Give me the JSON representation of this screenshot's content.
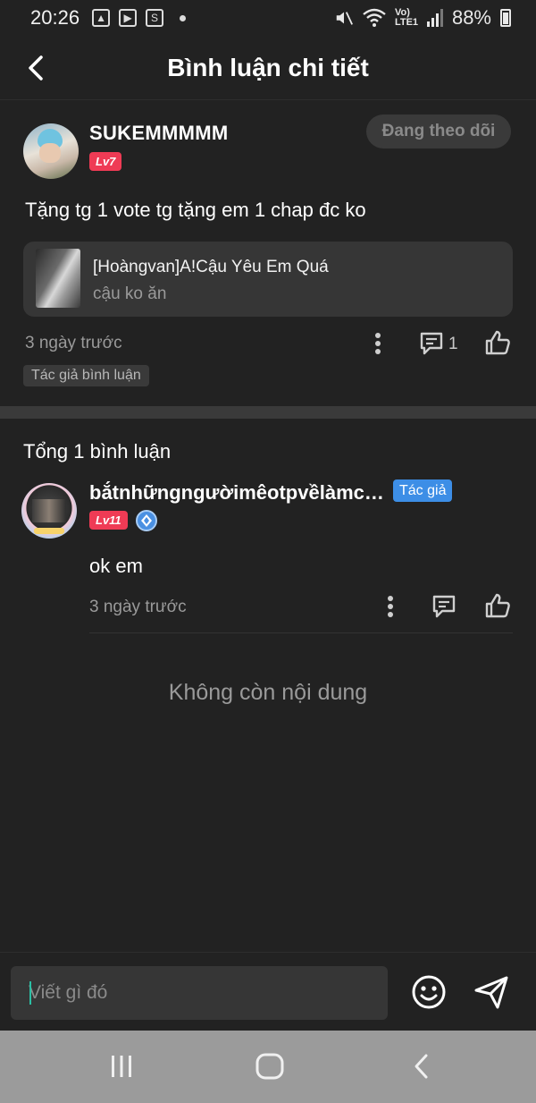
{
  "status_bar": {
    "time": "20:26",
    "network": "Vo) LTE1",
    "battery": "88%"
  },
  "header": {
    "title": "Bình luận chi tiết"
  },
  "post": {
    "username": "SUKEMMMMM",
    "level": "Lv7",
    "follow_label": "Đang theo dõi",
    "text": "Tặng tg 1 vote tg tặng em 1 chap đc ko",
    "manga_title": "[Hoàngvan]A!Cậu Yêu Em Quá",
    "manga_sub": "cậu ko ăn",
    "time": "3 ngày trước",
    "reply_count": "1",
    "author_chip": "Tác giả bình luận"
  },
  "comments": {
    "count_label": "Tổng 1 bình luận",
    "items": [
      {
        "username": "bắtnhữngngườimêotpvềlàmch...",
        "author_tag": "Tác giả",
        "level": "Lv11",
        "text": "ok em",
        "time": "3 ngày trước"
      }
    ],
    "end_label": "Không còn nội dung"
  },
  "input": {
    "placeholder": "Viết gì đó"
  },
  "colors": {
    "background": "#222222",
    "level_badge": "#ef3b55",
    "author_tag": "#3d8ee6",
    "card": "#363636"
  },
  "icons": [
    "back-icon",
    "more-icon",
    "reply-icon",
    "like-icon",
    "emoji-icon",
    "send-icon",
    "recent-apps-icon",
    "home-icon",
    "nav-back-icon"
  ]
}
